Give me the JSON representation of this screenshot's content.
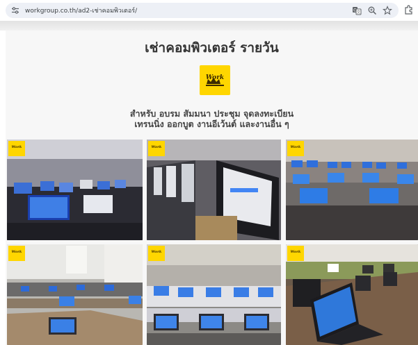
{
  "browser": {
    "url": "workgroup.co.th/ad2-เช่าคอมพิวเตอร์/",
    "icons": [
      "tune-icon",
      "translate-icon",
      "zoom-icon",
      "bookmark-star-icon",
      "extensions-icon"
    ]
  },
  "page": {
    "title": "เช่าคอมพิวเตอร์ รายวัน",
    "subtitle_line1": "สำหรับ อบรม สัมมนา ประชุม จุดลงทะเบียน",
    "subtitle_line2": "เทรนนิ่ง ออกบูต งานอีเว้นต์ และงานอื่น ๆ"
  },
  "logo": {
    "text": "Work"
  },
  "photos": [
    {
      "name": "training-room-desktops",
      "badge": "Work"
    },
    {
      "name": "lab-monitors-closeup",
      "badge": "Work"
    },
    {
      "name": "laptop-rows-conference",
      "badge": "Work"
    },
    {
      "name": "classroom-laptops-bright",
      "badge": "Work"
    },
    {
      "name": "seminar-hall-laptops",
      "badge": "Work"
    },
    {
      "name": "laptops-long-table",
      "badge": "Work"
    }
  ],
  "colors": {
    "brand_yellow": "#ffd600",
    "omnibox": "#edf0f6",
    "page_bg": "#f7f7f7",
    "title_text": "#333333"
  }
}
